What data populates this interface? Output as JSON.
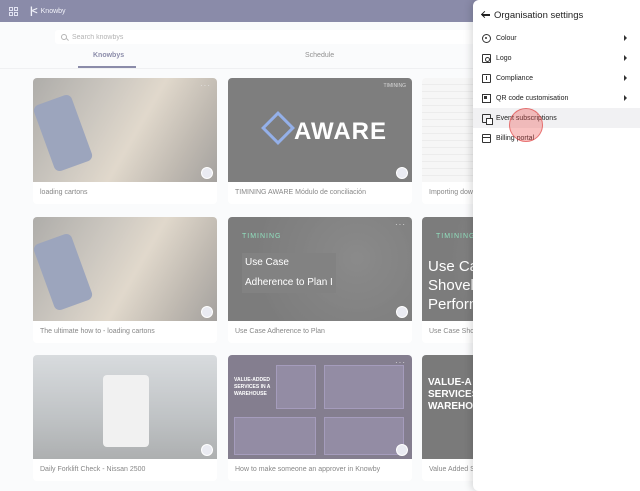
{
  "topbar": {
    "brand": "Knowby"
  },
  "search": {
    "placeholder": "Search knowbys"
  },
  "tabs": [
    {
      "label": "Knowbys"
    },
    {
      "label": "Schedule"
    }
  ],
  "cards": [
    {
      "title": "loading cartons"
    },
    {
      "title": "TIMINING AWARE  Módulo de conciliación",
      "thumb_brand": "TIMINING",
      "thumb_word": "AWARE"
    },
    {
      "title": "Importing dow"
    },
    {
      "title": "The ultimate how to -  loading cartons"
    },
    {
      "title": "Use Case Adherence to Plan",
      "thumb_brand": "TIMINING",
      "thumb_line1": "Use Case",
      "thumb_line2": "Adherence to Plan I"
    },
    {
      "title": "Use Case Sho",
      "thumb_brand": "TIMINING",
      "thumb_line1": "Use Cas",
      "thumb_line2": "Shovel",
      "thumb_line3": "Perform"
    },
    {
      "title": "Daily Forklift Check - Nissan 2500"
    },
    {
      "title": "How to make someone an approver in Knowby",
      "thumb_line1": "VALUE-ADDED SERVICES IN A WAREHOUSE"
    },
    {
      "title": "Value Added S",
      "thumb_line1": "VALUE-A",
      "thumb_line2": "SERVICES",
      "thumb_line3": "WAREHOU"
    }
  ],
  "panel": {
    "title": "Organisation settings",
    "items": [
      {
        "label": "Colour",
        "icon": "palette-icon",
        "has_submenu": true
      },
      {
        "label": "Logo",
        "icon": "image-icon",
        "has_submenu": true
      },
      {
        "label": "Compliance",
        "icon": "compliance-icon",
        "has_submenu": true
      },
      {
        "label": "QR code customisation",
        "icon": "qr-code-icon",
        "has_submenu": true
      },
      {
        "label": "Event subscriptions",
        "icon": "event-subscription-icon",
        "has_submenu": false
      },
      {
        "label": "Billing portal",
        "icon": "billing-icon",
        "has_submenu": false
      }
    ]
  },
  "colors": {
    "topbar": "#2b2d63",
    "accent": "#2b2d63",
    "timing_green": "#37c98b",
    "click_marker": "#ef5350"
  }
}
